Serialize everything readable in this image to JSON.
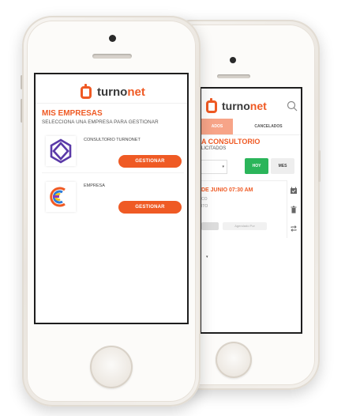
{
  "front": {
    "brand_name": "turnonet",
    "section_title": "MIS EMPRESAS",
    "section_subtitle": "SELECCIONA UNA EMPRESA PARA GESTIONAR",
    "companies": [
      {
        "name": "CONSULTORIO TURNONET",
        "button": "GESTIONAR"
      },
      {
        "name": "EMPRESA",
        "button": "GESTIONAR"
      }
    ]
  },
  "back": {
    "brand_name": "turnonet",
    "tabs": [
      "ADOS",
      "CANCELADOS"
    ],
    "title": "A CONSULTORIO",
    "subtitle": "LICITADOS",
    "filter": {
      "today": "HOY",
      "month": "MES"
    },
    "appointment": {
      "datetime": "DE JUNIO 07:30 AM",
      "line1": "CO",
      "line2": "ITO",
      "actions": [
        "",
        "Agendado Por"
      ]
    }
  },
  "colors": {
    "accent": "#ef5a24",
    "green": "#2bb55a"
  }
}
